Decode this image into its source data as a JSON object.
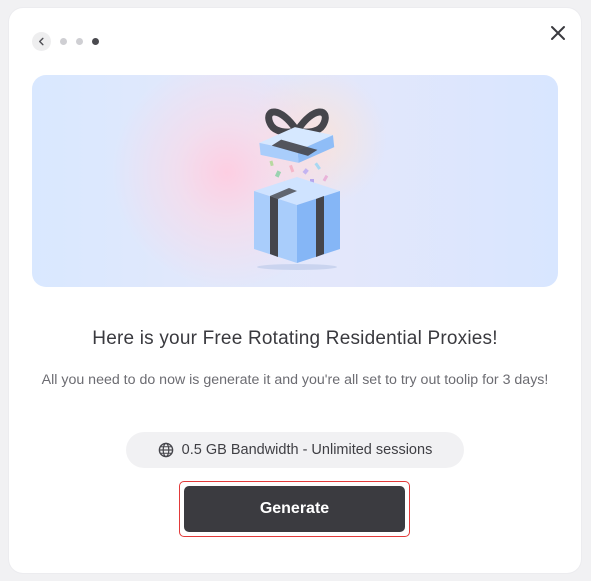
{
  "dialog": {
    "steps": {
      "total": 3,
      "current": 3
    },
    "title": "Here is your Free Rotating Residential Proxies!",
    "description": "All you need to do now is generate it and you're all set to try out toolip for 3 days!",
    "plan": {
      "icon": "globe-icon",
      "text": "0.5 GB Bandwidth - Unlimited sessions"
    },
    "generate_label": "Generate",
    "icons": {
      "back": "chevron-left-icon",
      "close": "close-icon",
      "illustration": "gift-box-illustration"
    },
    "colors": {
      "primary_button": "#3b3b40",
      "highlight_border": "#e23a3a",
      "hero_gradient_start": "#d9e8ff",
      "hero_gradient_end": "#d8e6ff"
    }
  }
}
